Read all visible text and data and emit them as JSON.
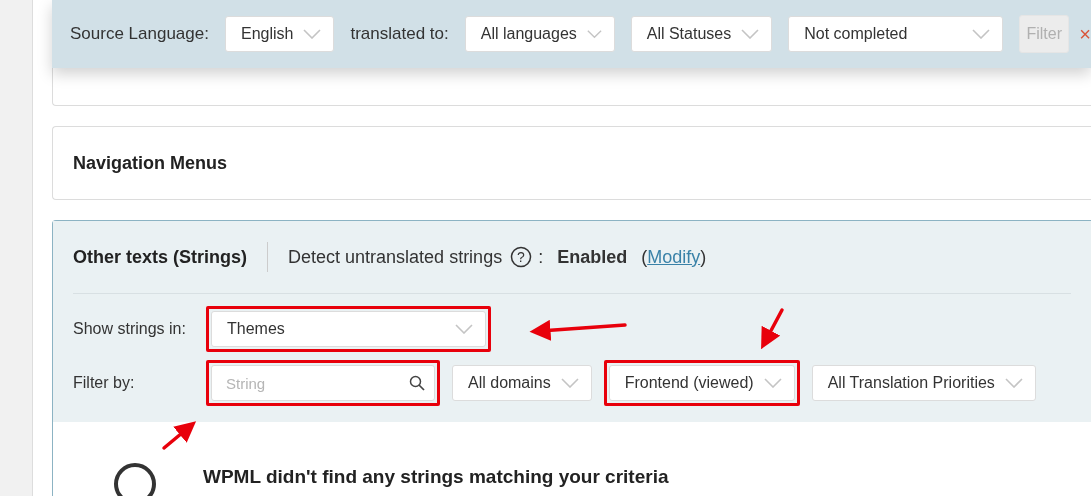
{
  "filter_bar": {
    "source_label": "Source Language:",
    "source": "English",
    "translated_label": "translated to:",
    "selects": [
      {
        "value": "All languages"
      },
      {
        "value": "All Statuses"
      },
      {
        "value": "Not completed"
      }
    ],
    "filter_button": {
      "label": "Filter",
      "disabled": true
    },
    "close": "×"
  },
  "sections": [
    {
      "title": "Navigation Menus"
    }
  ],
  "strings_section": {
    "title": "Other texts (Strings)",
    "detect_label": "Detect untranslated strings",
    "help": "?",
    "separator": ":",
    "status": "Enabled",
    "modify_prefix": "(",
    "modify_link": "Modify",
    "modify_suffix": ")",
    "show_label": "Show strings in:",
    "show": {
      "value": "Themes",
      "highlighted": true
    },
    "filter_label": "Filter by:",
    "search": {
      "placeholder": "String",
      "highlighted": true
    },
    "filters": [
      {
        "value": "All domains",
        "highlighted": false
      },
      {
        "value": "Frontend (viewed)",
        "highlighted": true
      },
      {
        "value": "All Translation Priorities",
        "highlighted": false
      }
    ],
    "empty_message": "WPML didn't find any strings matching your criteria"
  }
}
